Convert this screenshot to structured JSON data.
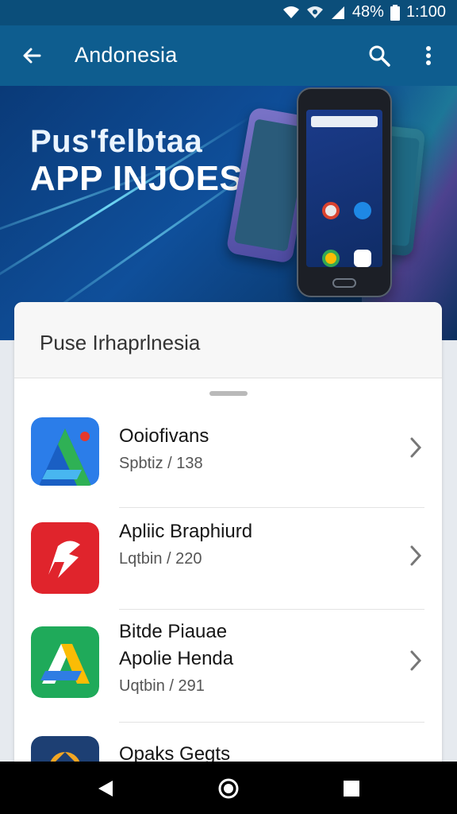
{
  "status_bar": {
    "battery": "48%",
    "time": "1:100",
    "icons": [
      "wifi-icon",
      "signal-icon",
      "signal-bars-icon",
      "battery-icon"
    ]
  },
  "app_bar": {
    "title": "Andonesia",
    "icons": [
      "back-arrow-icon",
      "search-icon",
      "more-vert-icon"
    ]
  },
  "banner": {
    "line1": "Pus'felbtaa",
    "line2": "APP INJOESIN"
  },
  "panel": {
    "title": "Puse Irhaprlnesia",
    "items": [
      {
        "name": "Ooiofivans",
        "meta": "Spbtiz / 138",
        "icon": "blue-green-a-icon"
      },
      {
        "name": "Apliic Braphiurd",
        "meta": "Lqtbin / 220",
        "icon": "red-logo-icon"
      },
      {
        "name": "Bitde Piauae Apolie Henda",
        "name_lines": [
          "Bitde Piauae",
          "Apolie Henda"
        ],
        "meta": "Uqtbin / 291",
        "icon": "green-a-icon"
      },
      {
        "name": "Opaks Gegts",
        "meta": "",
        "icon": "navy-orange-icon"
      }
    ]
  },
  "nav_bar": {
    "icons": [
      "back-triangle-icon",
      "home-circle-icon",
      "recents-square-icon"
    ]
  },
  "colors": {
    "status_bar": "#0b4e7a",
    "app_bar": "#0e5d8f",
    "banner": "#0f4f9a",
    "card": "#ffffff"
  }
}
